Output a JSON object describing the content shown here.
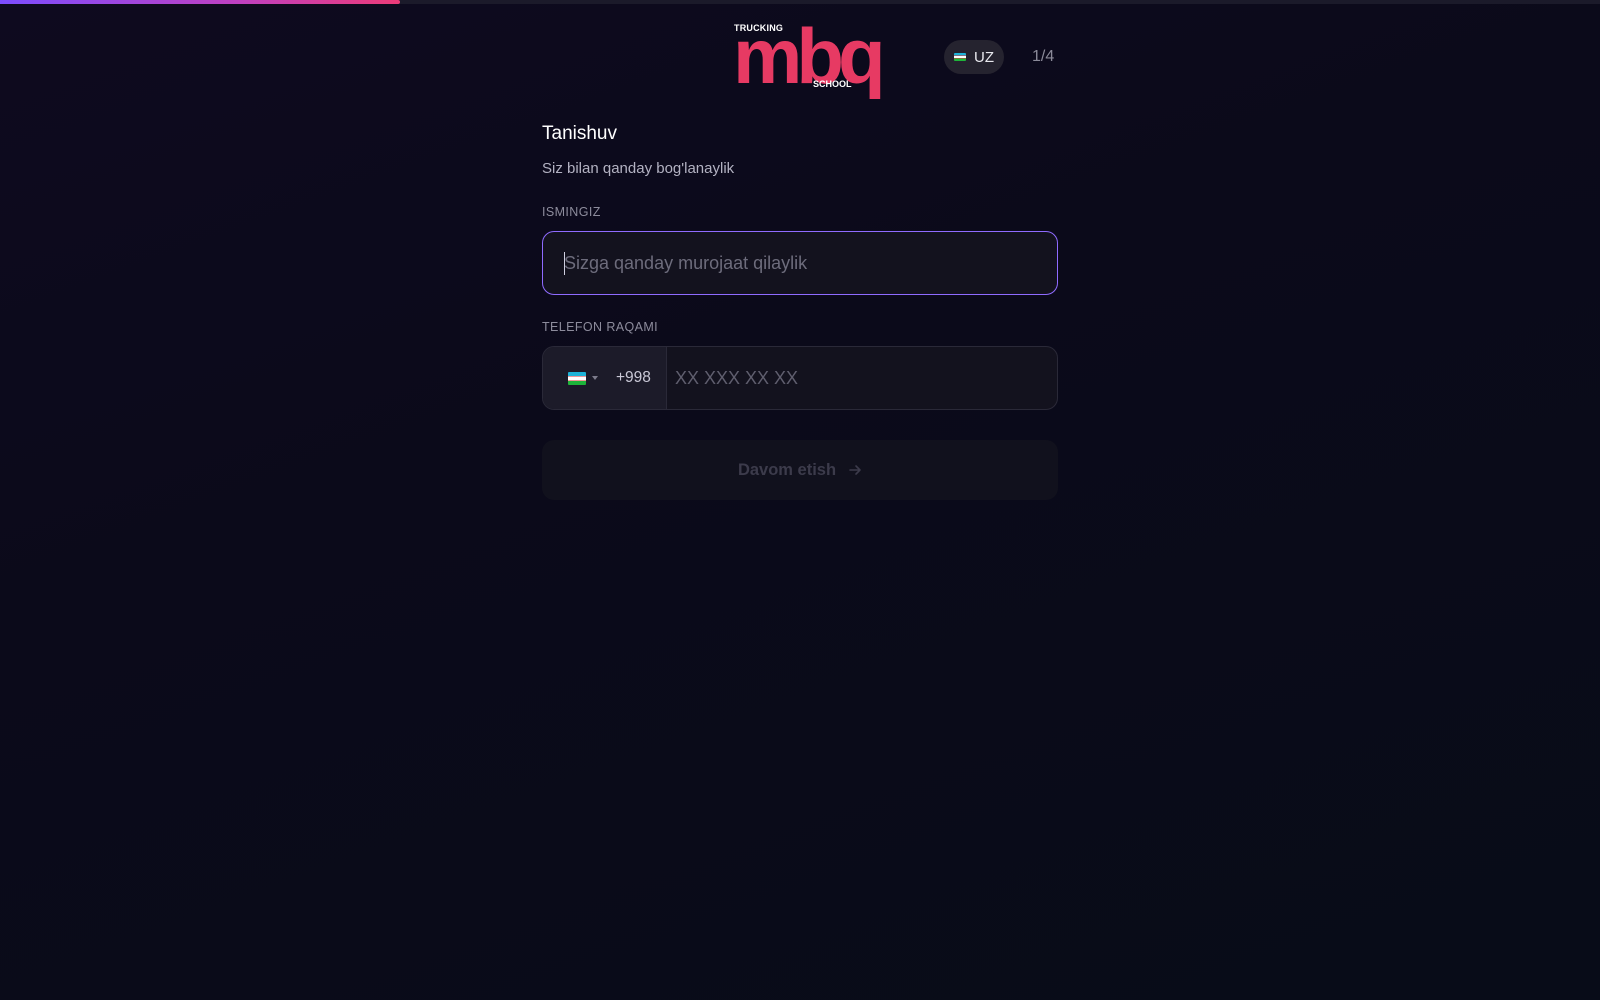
{
  "progress": {
    "value": 0.25
  },
  "brand": {
    "logo_top": "TRUCKING",
    "logo_main": "mbq",
    "logo_bottom": "SCHOOL",
    "color": "#e73a63"
  },
  "header": {
    "language": {
      "flag_icon": "uzbekistan-flag-icon",
      "code": "UZ"
    },
    "step": "1/4"
  },
  "form": {
    "title": "Tanishuv",
    "subtitle": "Siz bilan qanday bog'lanaylik",
    "name": {
      "label": "ISMINGIZ",
      "placeholder": "Sizga qanday murojaat qilaylik",
      "value": ""
    },
    "phone": {
      "label": "TELEFON RAQAMI",
      "country_flag_icon": "uzbekistan-flag-icon",
      "dial_code": "+998",
      "placeholder": "XX XXX XX XX",
      "value": ""
    },
    "submit": {
      "label": "Davom etish",
      "icon": "arrow-right-icon",
      "disabled": true
    }
  },
  "colors": {
    "accent": "#8f6bff",
    "progress_start": "#7c4dff",
    "progress_end": "#ec3b78"
  }
}
